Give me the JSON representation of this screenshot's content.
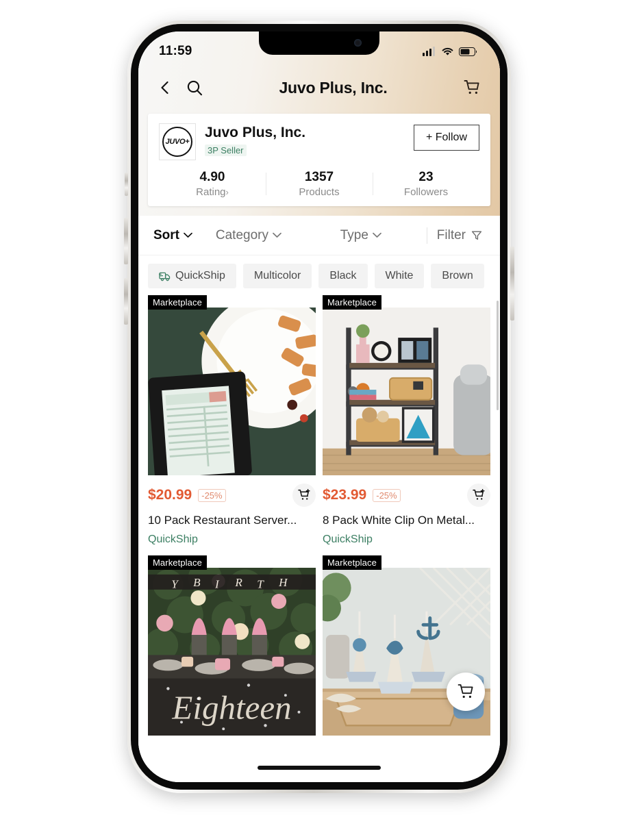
{
  "status_bar": {
    "time": "11:59",
    "signal_icon": "cellular-signal-icon",
    "wifi_icon": "wifi-icon",
    "battery_icon": "battery-icon"
  },
  "nav": {
    "back_icon": "chevron-left-icon",
    "search_icon": "search-icon",
    "title": "Juvo Plus, Inc.",
    "cart_icon": "shopping-cart-icon"
  },
  "seller": {
    "logo_text": "JUVO+",
    "name": "Juvo Plus, Inc.",
    "tag": "3P Seller",
    "follow_label": "+ Follow",
    "stats": [
      {
        "value": "4.90",
        "label": "Rating",
        "chevron": "›"
      },
      {
        "value": "1357",
        "label": "Products",
        "chevron": ""
      },
      {
        "value": "23",
        "label": "Followers",
        "chevron": ""
      }
    ]
  },
  "sort_bar": {
    "sort_label": "Sort",
    "category_label": "Category",
    "type_label": "Type",
    "filter_label": "Filter",
    "chevron_icon": "chevron-down-icon",
    "funnel_icon": "funnel-icon"
  },
  "chips": [
    {
      "label": "QuickShip",
      "icon": "quickship-truck-icon"
    },
    {
      "label": "Multicolor",
      "icon": ""
    },
    {
      "label": "Black",
      "icon": ""
    },
    {
      "label": "White",
      "icon": ""
    },
    {
      "label": "Brown",
      "icon": ""
    }
  ],
  "products": [
    {
      "badge": "Marketplace",
      "price": "$20.99",
      "discount": "-25%",
      "title": "10 Pack Restaurant Server...",
      "shipping": "QuickShip",
      "add_icon": "add-to-cart-icon"
    },
    {
      "badge": "Marketplace",
      "price": "$23.99",
      "discount": "-25%",
      "title": "8 Pack White Clip On Metal...",
      "shipping": "QuickShip",
      "add_icon": "add-to-cart-icon"
    },
    {
      "badge": "Marketplace",
      "price": "",
      "discount": "",
      "title": "",
      "shipping": "",
      "add_icon": ""
    },
    {
      "badge": "Marketplace",
      "price": "",
      "discount": "",
      "title": "",
      "shipping": "",
      "add_icon": ""
    }
  ],
  "fab": {
    "icon": "shopping-cart-icon"
  },
  "colors": {
    "price_accent": "#e25a33",
    "quickship_green": "#3c7f63",
    "badge_black": "#000000",
    "header_gradient_end": "#e3c8a5"
  }
}
